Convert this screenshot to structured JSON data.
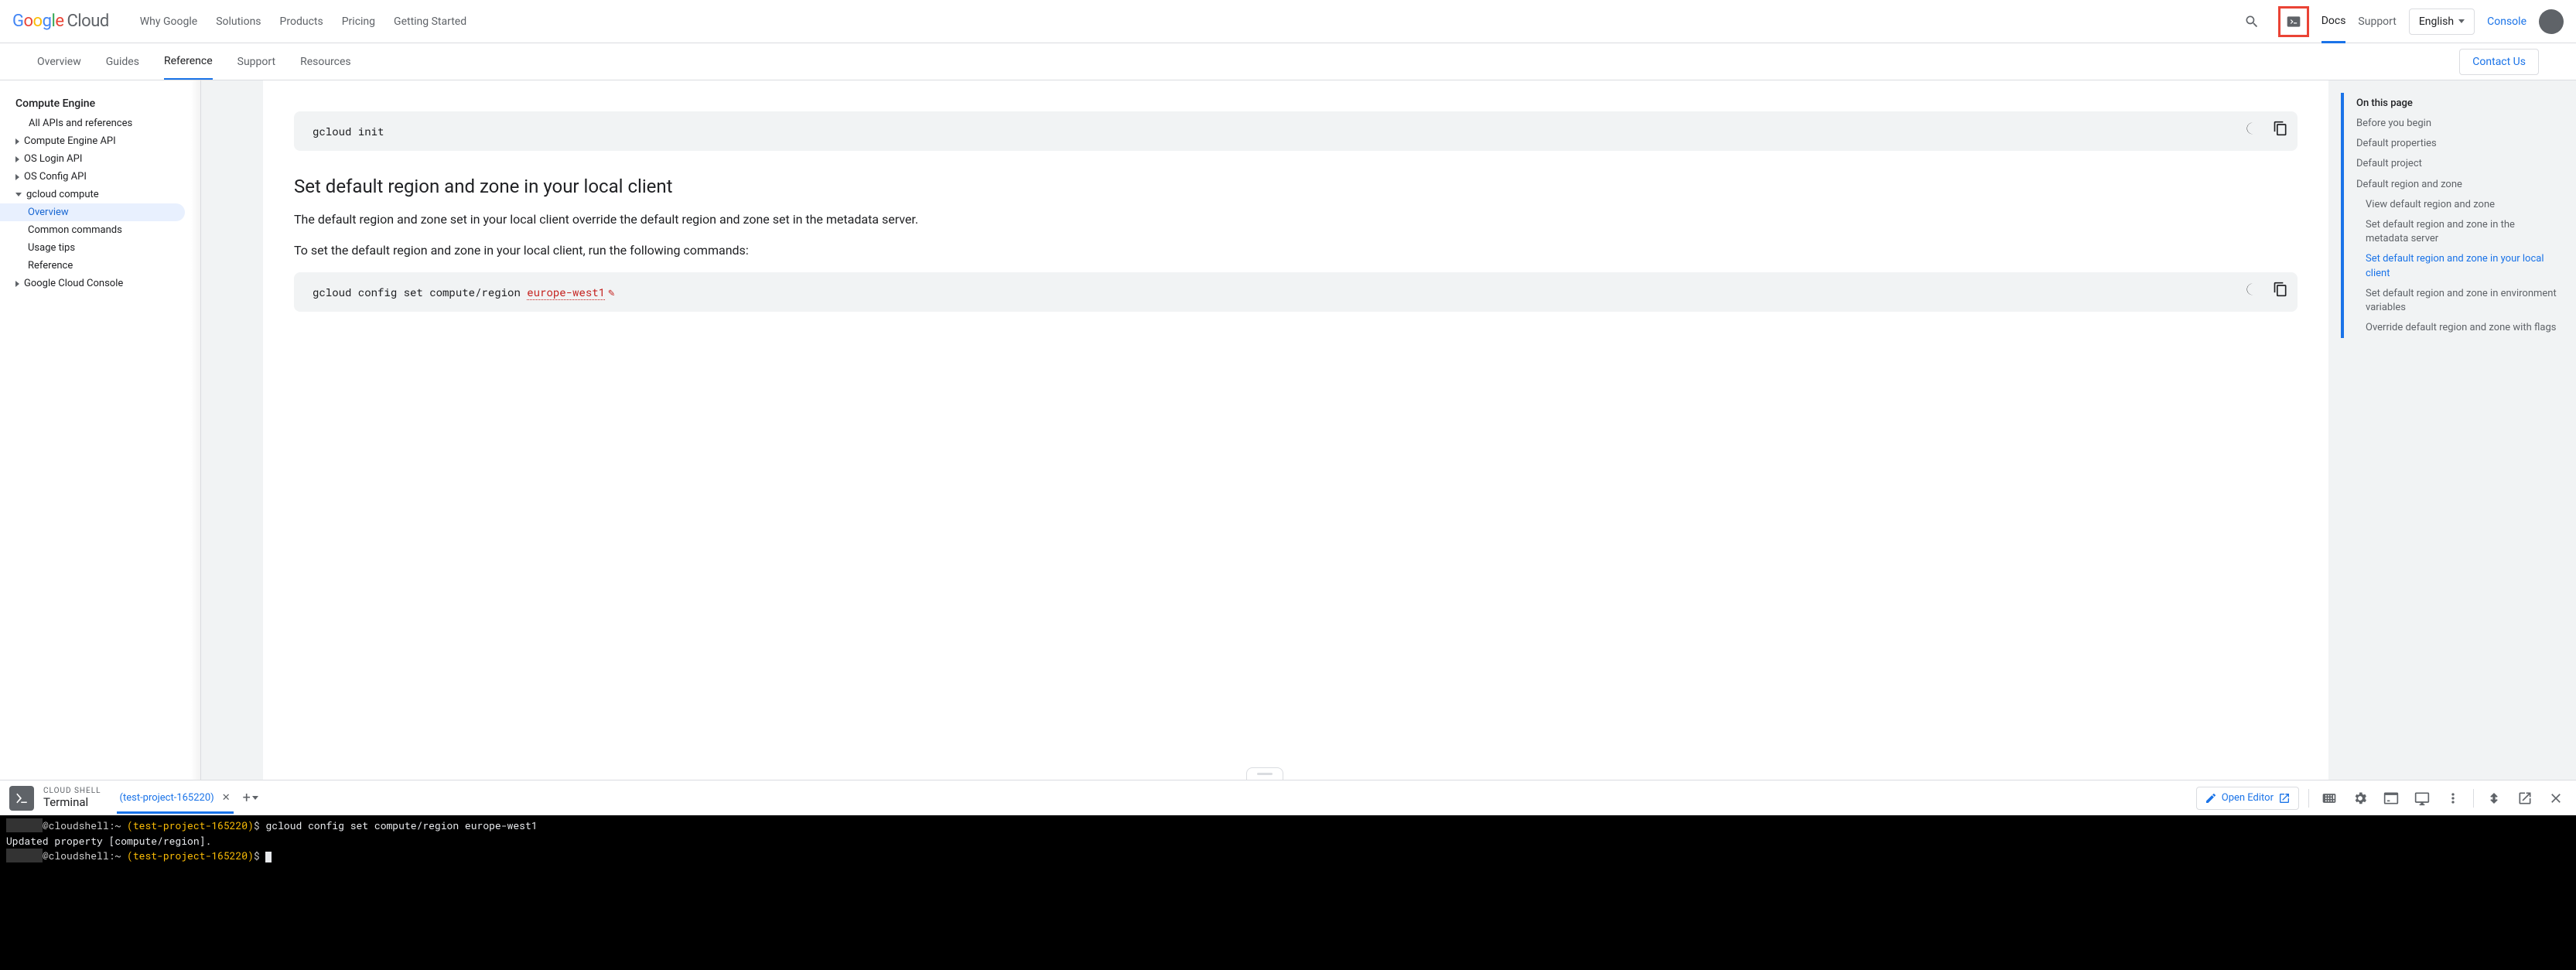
{
  "header": {
    "logo_cloud": "Cloud",
    "nav": [
      "Why Google",
      "Solutions",
      "Products",
      "Pricing",
      "Getting Started"
    ],
    "docs": "Docs",
    "support": "Support",
    "language": "English",
    "console": "Console"
  },
  "subnav": {
    "items": [
      "Overview",
      "Guides",
      "Reference",
      "Support",
      "Resources"
    ],
    "active_index": 2,
    "contact": "Contact Us"
  },
  "sidebar_left": {
    "title": "Compute Engine",
    "items": [
      {
        "label": "All APIs and references",
        "indent": 0,
        "caret": null
      },
      {
        "label": "Compute Engine API",
        "indent": 0,
        "caret": "right"
      },
      {
        "label": "OS Login API",
        "indent": 0,
        "caret": "right"
      },
      {
        "label": "OS Config API",
        "indent": 0,
        "caret": "right"
      },
      {
        "label": "gcloud compute",
        "indent": 0,
        "caret": "down"
      },
      {
        "label": "Overview",
        "indent": 1,
        "caret": null,
        "active": true
      },
      {
        "label": "Common commands",
        "indent": 1,
        "caret": null
      },
      {
        "label": "Usage tips",
        "indent": 1,
        "caret": null
      },
      {
        "label": "Reference",
        "indent": 1,
        "caret": null
      },
      {
        "label": "Google Cloud Console",
        "indent": 0,
        "caret": "right"
      }
    ]
  },
  "article": {
    "code1": "gcloud init",
    "h2": "Set default region and zone in your local client",
    "p1": "The default region and zone set in your local client override the default region and zone set in the metadata server.",
    "p2": "To set the default region and zone in your local client, run the following commands:",
    "code2_prefix": "gcloud config set compute/region ",
    "code2_var": "europe-west1"
  },
  "toc": {
    "title": "On this page",
    "items": [
      {
        "label": "Before you begin",
        "indent": 0
      },
      {
        "label": "Default properties",
        "indent": 0
      },
      {
        "label": "Default project",
        "indent": 0
      },
      {
        "label": "Default region and zone",
        "indent": 0
      },
      {
        "label": "View default region and zone",
        "indent": 1
      },
      {
        "label": "Set default region and zone in the metadata server",
        "indent": 1
      },
      {
        "label": "Set default region and zone in your local client",
        "indent": 1,
        "active": true
      },
      {
        "label": "Set default region and zone in environment variables",
        "indent": 1
      },
      {
        "label": "Override default region and zone with flags",
        "indent": 1
      }
    ]
  },
  "shell": {
    "label_small": "CLOUD SHELL",
    "label": "Terminal",
    "tab": "(test-project-165220)",
    "open_editor": "Open Editor",
    "lines": [
      {
        "type": "prompt",
        "user_blank": "      ",
        "host": "@cloudshell:",
        "tilde": "~ ",
        "project": "(test-project-165220)",
        "dollar": "$ ",
        "cmd": "gcloud config set compute/region europe-west1"
      },
      {
        "type": "output",
        "text": "Updated property [compute/region]."
      },
      {
        "type": "prompt",
        "user_blank": "      ",
        "host": "@cloudshell:",
        "tilde": "~ ",
        "project": "(test-project-165220)",
        "dollar": "$ ",
        "cmd": "",
        "cursor": true
      }
    ]
  }
}
